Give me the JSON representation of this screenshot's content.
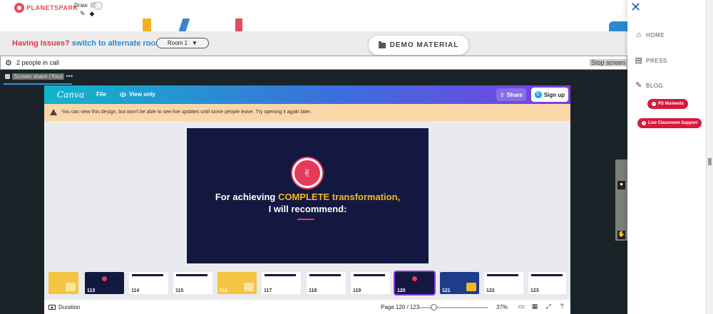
{
  "brand": {
    "logo_text": "PLANETSPARK"
  },
  "draw": {
    "label": "Draw"
  },
  "issue": {
    "question": "Having issues?",
    "link": "switch to alternate room",
    "room_select": "Room 1"
  },
  "demo": {
    "label": "DEMO MATERIAL"
  },
  "call": {
    "people": "2 people in call",
    "stop_screen": "Stop screen"
  },
  "share_tab": {
    "label": "Screen share (You)",
    "more": "•••"
  },
  "canva": {
    "logo": "Canva",
    "file": "File",
    "view_only": "View only",
    "share": "Share",
    "signup": "Sign up",
    "warning": "You can view this design, but won't be able to see live updates until some people leave. Try opening it again later."
  },
  "slide": {
    "line1_prefix": "For achieving ",
    "line1_accent": "COMPLETE transformation,",
    "line2": "I will recommend:"
  },
  "thumbnails": [
    {
      "num": "",
      "style": "yellow"
    },
    {
      "num": "113",
      "style": "dark"
    },
    {
      "num": "114",
      "style": "light"
    },
    {
      "num": "115",
      "style": "light"
    },
    {
      "num": "116",
      "style": "yellow"
    },
    {
      "num": "117",
      "style": "light"
    },
    {
      "num": "118",
      "style": "light"
    },
    {
      "num": "119",
      "style": "light"
    },
    {
      "num": "120",
      "style": "dark",
      "active": true
    },
    {
      "num": "121",
      "style": "blue"
    },
    {
      "num": "122",
      "style": "light"
    },
    {
      "num": "123",
      "style": "light"
    }
  ],
  "footer": {
    "duration": "Duration",
    "page": "Page 120 / 123",
    "zoom_value": 37,
    "zoom_label": "37%"
  },
  "menu": {
    "home": "HOME",
    "press": "PRESS",
    "blog": "BLOG",
    "ps_moments": "PS Moments",
    "live_support": "Live Classroom Support"
  },
  "colors": {
    "brand_red": "#e8495b",
    "link_blue": "#2a8bd0",
    "slide_bg": "#131841",
    "accent_yellow": "#f6b91f",
    "pill_red": "#d8183d"
  }
}
